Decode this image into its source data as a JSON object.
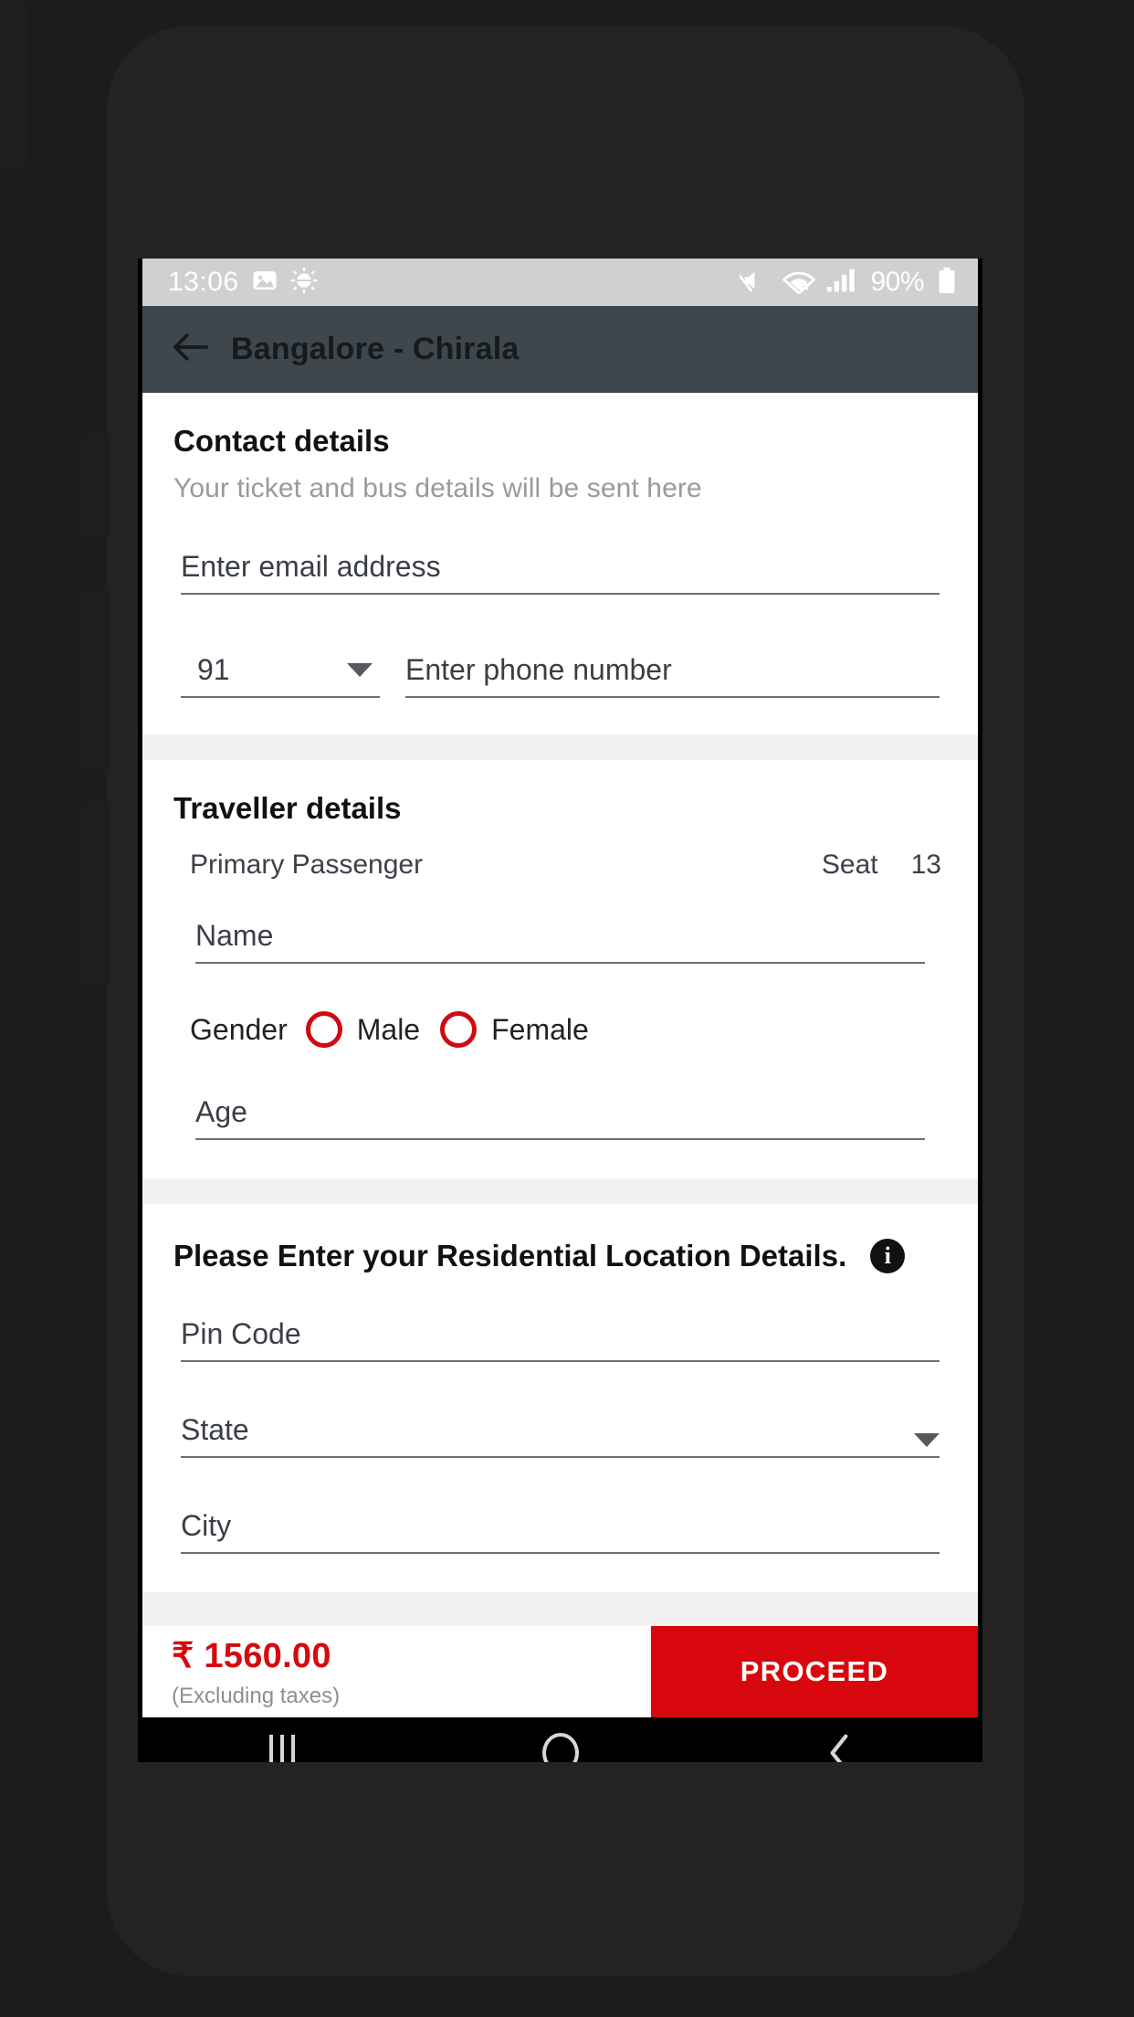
{
  "status_bar": {
    "time": "13:06",
    "left_icons": [
      "image-icon",
      "debug-gear-icon"
    ],
    "right_icons": [
      "mute-icon",
      "wifi-icon",
      "signal-icon",
      "battery-icon"
    ],
    "battery_percent": "90%",
    "background_color": "#d2d0cf"
  },
  "app_bar": {
    "back_icon": "back-arrow-icon",
    "title": "Bangalore - Chirala",
    "background_color": "#3e474d"
  },
  "contact": {
    "title": "Contact details",
    "subtitle": "Your ticket and bus details will be sent here",
    "email_placeholder": "Enter email address",
    "email_value": "",
    "country_code": "91",
    "country_code_icon": "chevron-down-icon",
    "phone_placeholder": "Enter phone number",
    "phone_value": ""
  },
  "traveller": {
    "title": "Traveller details",
    "passenger_label": "Primary Passenger",
    "seat_label": "Seat",
    "seat_number": "13",
    "name_placeholder": "Name",
    "name_value": "",
    "gender_label": "Gender",
    "gender_options": [
      "Male",
      "Female"
    ],
    "gender_selected": "",
    "gender_accent_color": "#cf0a10",
    "age_placeholder": "Age",
    "age_value": ""
  },
  "residential": {
    "title": "Please Enter your Residential Location Details.",
    "info_icon": "info-icon",
    "info_glyph": "i",
    "pin_placeholder": "Pin Code",
    "pin_value": "",
    "state_placeholder": "State",
    "state_value": "",
    "state_icon": "chevron-down-icon",
    "city_placeholder": "City",
    "city_value": ""
  },
  "bottom_bar": {
    "price": "₹ 1560.00",
    "price_note": "(Excluding taxes)",
    "price_color": "#d50a0f",
    "proceed_label": "PROCEED",
    "proceed_color": "#d8070d"
  },
  "nav_bar": {
    "recents_icon": "recents-icon",
    "home_icon": "home-icon",
    "back_icon": "nav-back-icon"
  }
}
